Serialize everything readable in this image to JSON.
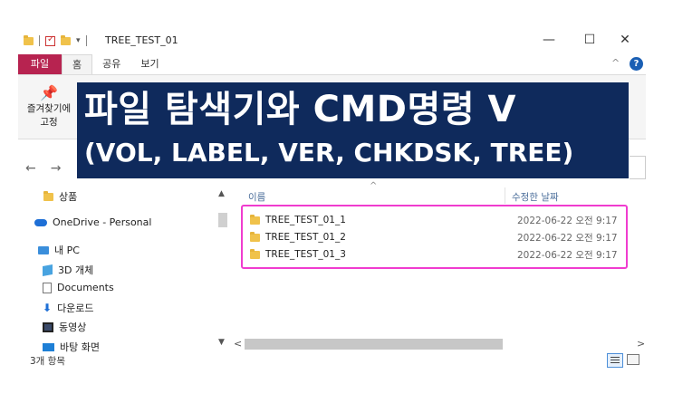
{
  "window": {
    "title": "TREE_TEST_01",
    "minimize": "—",
    "maximize": "☐",
    "close": "✕"
  },
  "ribbon": {
    "tabs": [
      "파일",
      "홈",
      "공유",
      "보기"
    ],
    "pin_label_line1": "즐겨찾기에",
    "pin_label_line2": "고정",
    "help": "?",
    "collapse": "^"
  },
  "banner": {
    "line1": "파일 탐색기와 CMD명령 V",
    "line2": "(VOL, LABEL, VER, CHKDSK, TREE)"
  },
  "nav": {
    "back": "←",
    "forward": "→"
  },
  "sidebar": {
    "items": [
      {
        "label": "상품",
        "icon": "folder-icon"
      },
      {
        "label": "OneDrive - Personal",
        "icon": "onedrive-icon"
      },
      {
        "label": "내 PC",
        "icon": "pc-icon"
      },
      {
        "label": "3D 개체",
        "icon": "3d-objects-icon"
      },
      {
        "label": "Documents",
        "icon": "document-icon"
      },
      {
        "label": "다운로드",
        "icon": "download-icon"
      },
      {
        "label": "동영상",
        "icon": "video-icon"
      },
      {
        "label": "바탕 화면",
        "icon": "desktop-icon"
      }
    ]
  },
  "columns": {
    "name": "이름",
    "date": "수정한 날짜"
  },
  "files": [
    {
      "name": "TREE_TEST_01_1",
      "date": "2022-06-22 오전 9:17"
    },
    {
      "name": "TREE_TEST_01_2",
      "date": "2022-06-22 오전 9:17"
    },
    {
      "name": "TREE_TEST_01_3",
      "date": "2022-06-22 오전 9:17"
    }
  ],
  "status": {
    "count": "3개 항목"
  },
  "colors": {
    "file_tab": "#b72350",
    "banner_bg": "#0f2a5c",
    "highlight": "#f03ccf",
    "folder": "#f0c24b"
  }
}
